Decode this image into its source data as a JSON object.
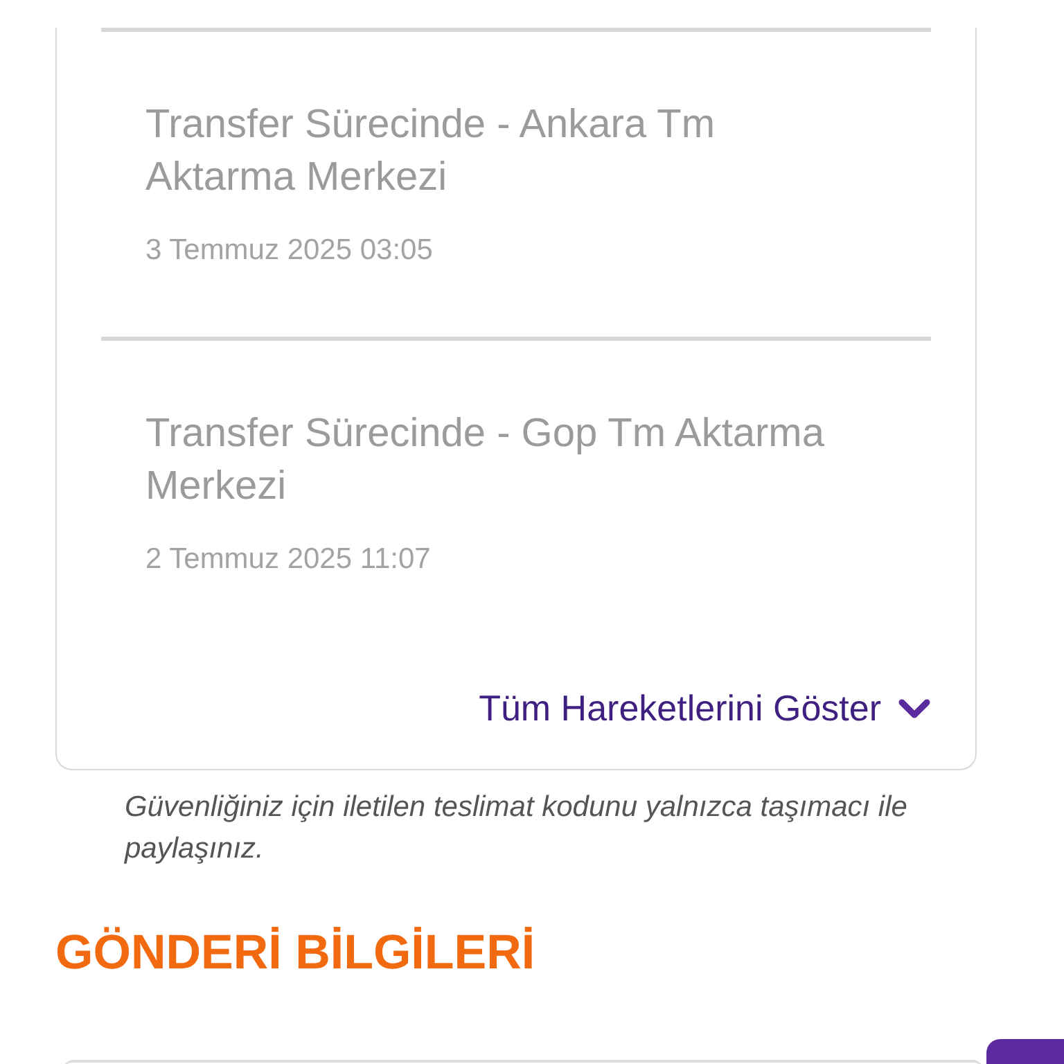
{
  "tracking_card": {
    "events": [
      {
        "title": "Transfer Sürecinde - Ankara Tm Aktarma Merkezi",
        "date": "3 Temmuz 2025 03:05"
      },
      {
        "title": "Transfer Sürecinde - Gop Tm Aktarma Merkezi",
        "date": "2 Temmuz 2025 11:07"
      }
    ],
    "show_all_link": "Tüm Hareketlerini Göster"
  },
  "security_note": "Güvenliğiniz için iletilen teslimat kodunu yalnızca taşımacı ile paylaşınız.",
  "shipment_section": {
    "heading": "GÖNDERİ BİLGİLERİ"
  }
}
